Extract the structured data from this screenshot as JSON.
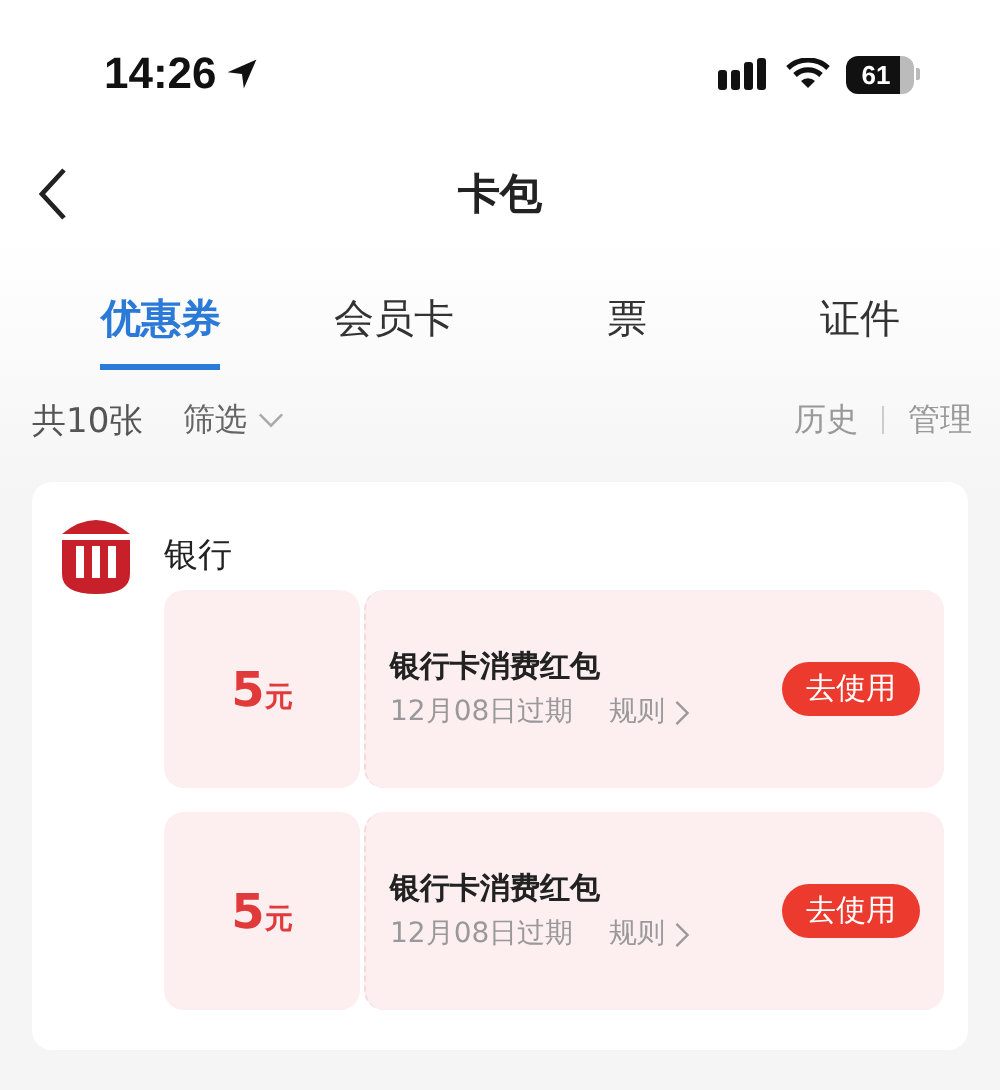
{
  "status_bar": {
    "time": "14:26",
    "battery": "61"
  },
  "nav_bar": {
    "title": "卡包"
  },
  "tabs": [
    {
      "label": "优惠券",
      "selected": true
    },
    {
      "label": "会员卡",
      "selected": false
    },
    {
      "label": "票",
      "selected": false
    },
    {
      "label": "证件",
      "selected": false
    }
  ],
  "toolbar": {
    "count": "共10张",
    "filter": "筛选",
    "history": "历史",
    "manage": "管理"
  },
  "group": {
    "name": "银行",
    "coupons": [
      {
        "amount": "5",
        "unit": "元",
        "title": "银行卡消费红包",
        "expiry": "12月08日过期",
        "rules": "规则",
        "action": "去使用"
      },
      {
        "amount": "5",
        "unit": "元",
        "title": "银行卡消费红包",
        "expiry": "12月08日过期",
        "rules": "规则",
        "action": "去使用"
      }
    ]
  }
}
